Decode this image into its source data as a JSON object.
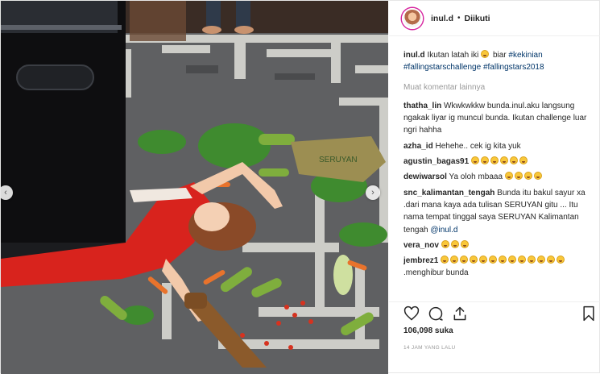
{
  "post": {
    "author": "inul.d",
    "separator": "•",
    "follow_status": "Diikuti",
    "caption": {
      "user": "inul.d",
      "text": "Ikutan latah iki",
      "after_emoji": "biar",
      "hashtags": [
        "#kekinian",
        "#fallingstarschallenge",
        "#fallingstars2018"
      ]
    },
    "load_more_label": "Muat komentar lainnya",
    "comments": [
      {
        "user": "thatha_lin",
        "text": "Wkwkwkkw bunda.inul.aku langsung ngakak liyar ig muncul bunda. Ikutan challenge luar ngri hahha"
      },
      {
        "user": "azha_id",
        "text": "Hehehe.. cek ig kita yuk"
      },
      {
        "user": "agustin_bagas91",
        "emoji_count": 6
      },
      {
        "user": "dewiwarsol",
        "text": "Ya oloh mbaaa",
        "emoji_count": 4
      },
      {
        "user": "snc_kalimantan_tengah",
        "text": "Bunda itu bakul sayur xa .dari mana kaya ada tulisan SERUYAN gitu ... Itu nama tempat tinggal saya SERUYAN Kalimantan tengah",
        "mention": "@inul.d"
      },
      {
        "user": "vera_nov",
        "emoji_count": 3
      },
      {
        "user": "jembrez1",
        "emoji_count": 13,
        "text": ".menghibur bunda"
      }
    ],
    "likes": "106,098 suka",
    "time_ago": "14 JAM YANG LALU"
  },
  "icons": {
    "like": "heart-icon",
    "comment": "comment-icon",
    "share": "share-icon",
    "save": "bookmark-icon",
    "prev": "chevron-left-icon",
    "next": "chevron-right-icon"
  },
  "colors": {
    "link": "#003569",
    "muted": "#999999",
    "text": "#262626",
    "story_ring": "#d6249f"
  }
}
